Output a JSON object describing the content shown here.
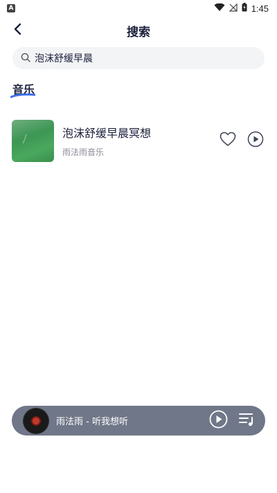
{
  "status_bar": {
    "time": "1:45",
    "app_badge": "A"
  },
  "header": {
    "title": "搜索"
  },
  "search": {
    "value": "泡沫舒缓早晨",
    "placeholder": ""
  },
  "section": {
    "title": "音乐"
  },
  "results": [
    {
      "title": "泡沫舒缓早晨冥想",
      "artist": "雨法雨音乐"
    }
  ],
  "mini_player": {
    "title": "雨法雨 - 听我想听"
  },
  "icons": {
    "back": "back-icon",
    "search": "search-icon",
    "like": "heart-icon",
    "play": "play-icon",
    "playlist": "playlist-icon",
    "wifi": "wifi-icon",
    "signal": "signal-icon",
    "battery": "battery-icon"
  },
  "colors": {
    "accent_underline": "#3d6fe8",
    "mini_player_bg": "#707788",
    "title_text": "#1b1f3b",
    "muted_text": "#8a8d99"
  }
}
